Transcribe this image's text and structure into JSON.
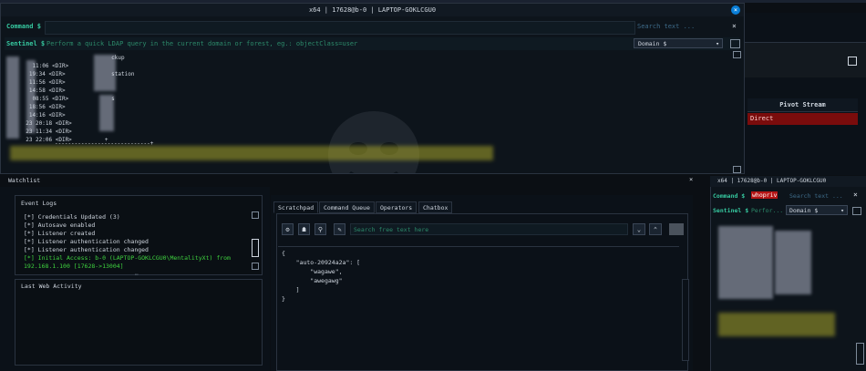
{
  "window": {
    "title": "x64 | 17628@b-0 | LAPTOP-GOKLCGU0",
    "close_glyph": "×"
  },
  "command_bar": {
    "label": "Command $",
    "search_placeholder": "Search text ...",
    "close_glyph": "×"
  },
  "sentinel_bar": {
    "label": "Sentinel $",
    "hint": "Perform a quick LDAP query in the current domain or forest, eg.: objectClass=user",
    "domain_select": "Domain $",
    "domain_arrow": "▾"
  },
  "listing": {
    "lines": [
      "                            ckup",
      "    11:06 <DIR>",
      "   19:34 <DIR>              station",
      "   11:56 <DIR>",
      "   14:58 <DIR>",
      "    08:55 <DIR>             s",
      "   18:56 <DIR>",
      "   14:16 <DIR>",
      "  23 20:18 <DIR>",
      "  23 11:34 <DIR>",
      "  23 22:06 <DIR>          +"
    ],
    "dashed_line": "-----------------------------+"
  },
  "right_panel": {
    "pivot_header": "Pivot Stream",
    "pivot_value": "Direct"
  },
  "watchlist": {
    "label": "Watchlist",
    "close_glyph": "×"
  },
  "event_logs": {
    "title": "Event Logs",
    "entries": [
      {
        "text": "[*] Credentials Updated (3)",
        "color": "#cfd6df"
      },
      {
        "text": "[*] Autosave enabled",
        "color": "#cfd6df"
      },
      {
        "text": "[*] Listener created",
        "color": "#cfd6df"
      },
      {
        "text": "[*] Listener authentication changed",
        "color": "#cfd6df"
      },
      {
        "text": "[*] Listener authentication changed",
        "color": "#cfd6df"
      },
      {
        "text": "[*] Initial Access: b-0 (LAPTOP-GOKLCGU0\\MentalityXt) from",
        "color": "#3fd33f"
      },
      {
        "text": "192.168.1.100 [17628->13004]",
        "color": "#3fd33f"
      }
    ],
    "splitter": "⋯"
  },
  "web_activity": {
    "title": "Last Web Activity"
  },
  "tabs": [
    {
      "label": "Scratchpad",
      "active": true
    },
    {
      "label": "Command Queue",
      "active": false
    },
    {
      "label": "Operators",
      "active": false
    },
    {
      "label": "Chatbox",
      "active": false
    }
  ],
  "scratchpad": {
    "search_placeholder": "Search free text here",
    "tool_icons": [
      "gear-icon",
      "users-icon",
      "key-icon",
      "edit-icon"
    ],
    "tool_glyphs": [
      "⚙",
      "☗",
      "⚲",
      "✎"
    ],
    "nav_glyphs": [
      "⌄",
      "⌃"
    ],
    "json_lines": [
      "{",
      "    \"auto-20924a2a\": [",
      "        \"wagawe\",",
      "        \"awegawg\"",
      "    ]",
      "}"
    ]
  },
  "mini_window": {
    "title": "x64 | 17628@b-0 | LAPTOP-GOKLCGU0",
    "command_label": "Command $",
    "command_value": "whopriv",
    "search_placeholder": "Search text ...",
    "sentinel_label": "Sentinel $",
    "sentinel_hint": "Perfor...",
    "domain_select": "Domain $",
    "domain_arrow": "▾",
    "close_glyph": "×"
  },
  "colors": {
    "accent_green": "#36c9a0",
    "success_green": "#3fd33f",
    "pivot_red": "#7a0c0c"
  }
}
